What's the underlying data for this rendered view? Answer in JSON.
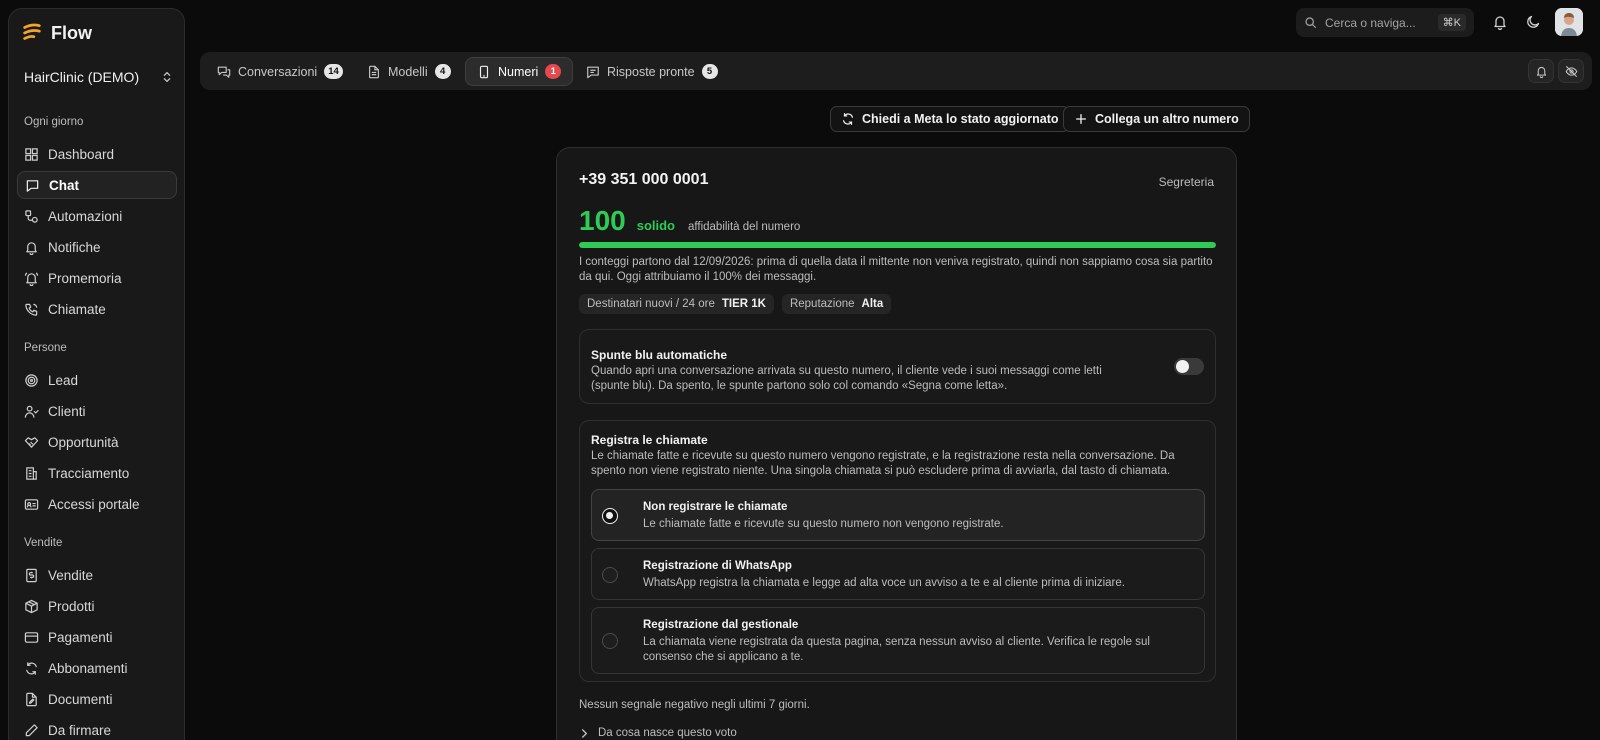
{
  "brand": {
    "name": "Flow"
  },
  "org": {
    "name": "HairClinic (DEMO)"
  },
  "sidebar": {
    "sections": [
      {
        "title": "Ogni giorno",
        "items": [
          "Dashboard",
          "Chat",
          "Automazioni",
          "Notifiche",
          "Promemoria",
          "Chiamate"
        ]
      },
      {
        "title": "Persone",
        "items": [
          "Lead",
          "Clienti",
          "Opportunità",
          "Tracciamento",
          "Accessi portale"
        ]
      },
      {
        "title": "Vendite",
        "items": [
          "Vendite",
          "Prodotti",
          "Pagamenti",
          "Abbonamenti",
          "Documenti",
          "Da firmare"
        ]
      }
    ],
    "active": "Chat"
  },
  "topbar": {
    "search_placeholder": "Cerca o naviga...",
    "search_shortcut": "⌘K"
  },
  "tabs": [
    {
      "label": "Conversazioni",
      "count": "14",
      "icon": "chat-bubbles-icon"
    },
    {
      "label": "Modelli",
      "count": "4",
      "icon": "document-icon"
    },
    {
      "label": "Numeri",
      "count": "1",
      "icon": "phone-device-icon",
      "active": true
    },
    {
      "label": "Risposte pronte",
      "count": "5",
      "icon": "message-template-icon"
    }
  ],
  "actions": {
    "refresh_label": "Chiedi a Meta lo stato aggiornato",
    "connect_label": "Collega un altro numero"
  },
  "number": {
    "phone": "+39 351 000 0001",
    "voicemail_label": "Segreteria",
    "score": "100",
    "score_word": "solido",
    "score_desc": "affidabilità del numero",
    "score_fraction": 1.0,
    "score_color": "#2ecc55",
    "note": "I conteggi partono dal 12/09/2026: prima di quella data il mittente non veniva registrato, quindi non sappiamo cosa sia partito da qui. Oggi attribuiamo il 100% dei messaggi.",
    "recipients_label": "Destinatari nuovi / 24 ore",
    "recipients_value": "TIER 1K",
    "reputation_label": "Reputazione",
    "reputation_value": "Alta"
  },
  "blue_ticks": {
    "title": "Spunte blu automatiche",
    "desc": "Quando apri una conversazione arrivata su questo numero, il cliente vede i suoi messaggi come letti (spunte blu). Da spento, le spunte partono solo col comando «Segna come letta».",
    "enabled": false
  },
  "recording": {
    "title": "Registra le chiamate",
    "desc": "Le chiamate fatte e ricevute su questo numero vengono registrate, e la registrazione resta nella conversazione. Da spento non viene registrato niente. Una singola chiamata si può escludere prima di avviarla, dal tasto di chiamata.",
    "options": [
      {
        "title": "Non registrare le chiamate",
        "desc": "Le chiamate fatte e ricevute su questo numero non vengono registrate.",
        "selected": true
      },
      {
        "title": "Registrazione di WhatsApp",
        "desc": "WhatsApp registra la chiamata e legge ad alta voce un avviso a te e al cliente prima di iniziare.",
        "selected": false
      },
      {
        "title": "Registrazione dal gestionale",
        "desc": "La chiamata viene registrata da questa pagina, senza nessun avviso al cliente. Verifica le regole sul consenso che si applicano a te.",
        "selected": false
      }
    ]
  },
  "footer": {
    "signals_note": "Nessun segnale negativo negli ultimi 7 giorni.",
    "details_label": "Da cosa nasce questo voto"
  }
}
